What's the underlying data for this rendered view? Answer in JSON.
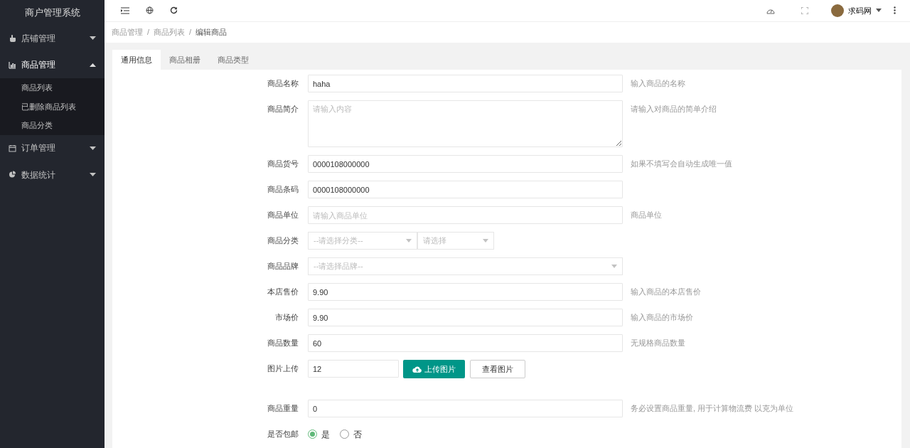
{
  "sidebar": {
    "title": "商户管理系统",
    "items": [
      {
        "label": "店铺管理",
        "expanded": false
      },
      {
        "label": "商品管理",
        "expanded": true,
        "children": [
          {
            "label": "商品列表"
          },
          {
            "label": "已删除商品列表"
          },
          {
            "label": "商品分类"
          }
        ]
      },
      {
        "label": "订单管理",
        "expanded": false
      },
      {
        "label": "数据统计",
        "expanded": false
      }
    ]
  },
  "header": {
    "user": "求码网"
  },
  "breadcrumb": {
    "separator": "/",
    "items": [
      "商品管理",
      "商品列表",
      "编辑商品"
    ]
  },
  "tabs": [
    {
      "label": "通用信息",
      "selected": true
    },
    {
      "label": "商品相册",
      "selected": false
    },
    {
      "label": "商品类型",
      "selected": false
    }
  ],
  "form": [
    {
      "kind": "text",
      "label": "商品名称",
      "value": "haha",
      "hint": "输入商品的名称"
    },
    {
      "kind": "textarea",
      "label": "商品简介",
      "placeholder": "请输入内容",
      "hint": "请输入对商品的简单介绍"
    },
    {
      "kind": "text",
      "label": "商品货号",
      "value": "0000108000000",
      "hint": "如果不填写会自动生成唯一值"
    },
    {
      "kind": "text",
      "label": "商品条码",
      "value": "0000108000000"
    },
    {
      "kind": "text",
      "label": "商品单位",
      "placeholder": "请输入商品单位",
      "hint": "商品单位"
    },
    {
      "kind": "selects",
      "label": "商品分类",
      "selects": [
        {
          "placeholder": "--请选择分类--"
        },
        {
          "placeholder": "请选择"
        }
      ]
    },
    {
      "kind": "select",
      "label": "商品品牌",
      "placeholder": "--请选择品牌--"
    },
    {
      "kind": "text",
      "label": "本店售价",
      "value": "9.90",
      "hint": "输入商品的本店售价"
    },
    {
      "kind": "text",
      "label": "市场价",
      "value": "9.90",
      "hint": "输入商品的市场价"
    },
    {
      "kind": "text",
      "label": "商品数量",
      "value": "60",
      "hint": "无规格商品数量"
    },
    {
      "kind": "upload",
      "label": "图片上传",
      "value": "12",
      "upload": "上传图片",
      "view": "查看图片"
    },
    {
      "kind": "text",
      "label": "商品重量",
      "value": "0",
      "hint": "务必设置商品重量, 用于计算物流费 以克为单位"
    },
    {
      "kind": "radio",
      "label": "是否包邮",
      "options": [
        {
          "label": "是",
          "selected": true
        },
        {
          "label": "否",
          "selected": false
        }
      ]
    }
  ]
}
